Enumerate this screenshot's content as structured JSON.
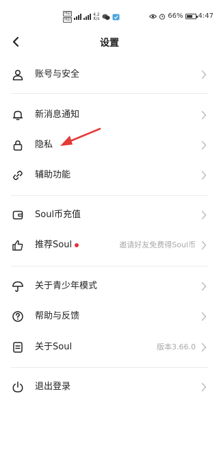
{
  "status_bar": {
    "sim1": "HD",
    "sim2": "HD",
    "net_speed_value": "4.2",
    "net_speed_unit": "K/s",
    "battery_percent": "66%",
    "battery_level": 0.66,
    "time": "4:47"
  },
  "header": {
    "title": "设置"
  },
  "settings": {
    "account": {
      "label": "账号与安全"
    },
    "notifications": {
      "label": "新消息通知"
    },
    "privacy": {
      "label": "隐私"
    },
    "accessibility": {
      "label": "辅助功能"
    },
    "recharge": {
      "label": "Soul币充值"
    },
    "recommend": {
      "label": "推荐Soul",
      "hint": "邀请好友免费得Soul币"
    },
    "teen_mode": {
      "label": "关于青少年模式"
    },
    "help": {
      "label": "帮助与反馈"
    },
    "about": {
      "label": "关于Soul",
      "hint": "版本3.66.0"
    },
    "logout": {
      "label": "退出登录"
    }
  },
  "colors": {
    "annotation_arrow": "#e53935",
    "badge_dot": "#e8303c",
    "divider": "#ececec",
    "hint_text": "#a9a9a9"
  },
  "icons": {
    "account": "person-icon",
    "notifications": "bell-icon",
    "privacy": "lock-icon",
    "accessibility": "link-icon",
    "recharge": "wallet-icon",
    "recommend": "thumbs-up-icon",
    "teen_mode": "umbrella-icon",
    "help": "question-circle-icon",
    "about": "document-icon",
    "logout": "power-icon"
  }
}
